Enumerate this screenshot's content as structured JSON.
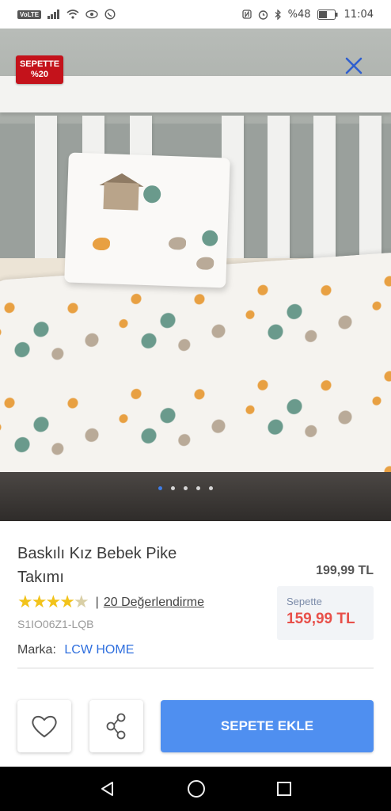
{
  "status_bar": {
    "volte": "VoLTE",
    "battery": "%48",
    "time": "11:04"
  },
  "hero": {
    "badge_line1": "SEPETTE",
    "badge_line2": "%20",
    "close_icon": "close-icon",
    "carousel": {
      "total": 5,
      "active": 1
    }
  },
  "product": {
    "title": "Baskılı Kız Bebek Pike Takımı",
    "old_price": "199,99 TL",
    "rating_stars": "★★★★★",
    "rating_value": 4.5,
    "reviews": "20 Değerlendirme",
    "sku": "S1IO06Z1-LQB",
    "cart_label": "Sepette",
    "cart_price": "159,99 TL",
    "brand_label": "Marka:",
    "brand_name": "LCW HOME"
  },
  "actions": {
    "favorite_icon": "heart-icon",
    "share_icon": "share-icon",
    "add_to_cart": "SEPETE EKLE"
  },
  "colors": {
    "accent": "#4f8ff0",
    "badge": "#c4121b",
    "sale_price": "#e8504a",
    "brand_link": "#2f6fde",
    "stars": "#f2c31b"
  }
}
